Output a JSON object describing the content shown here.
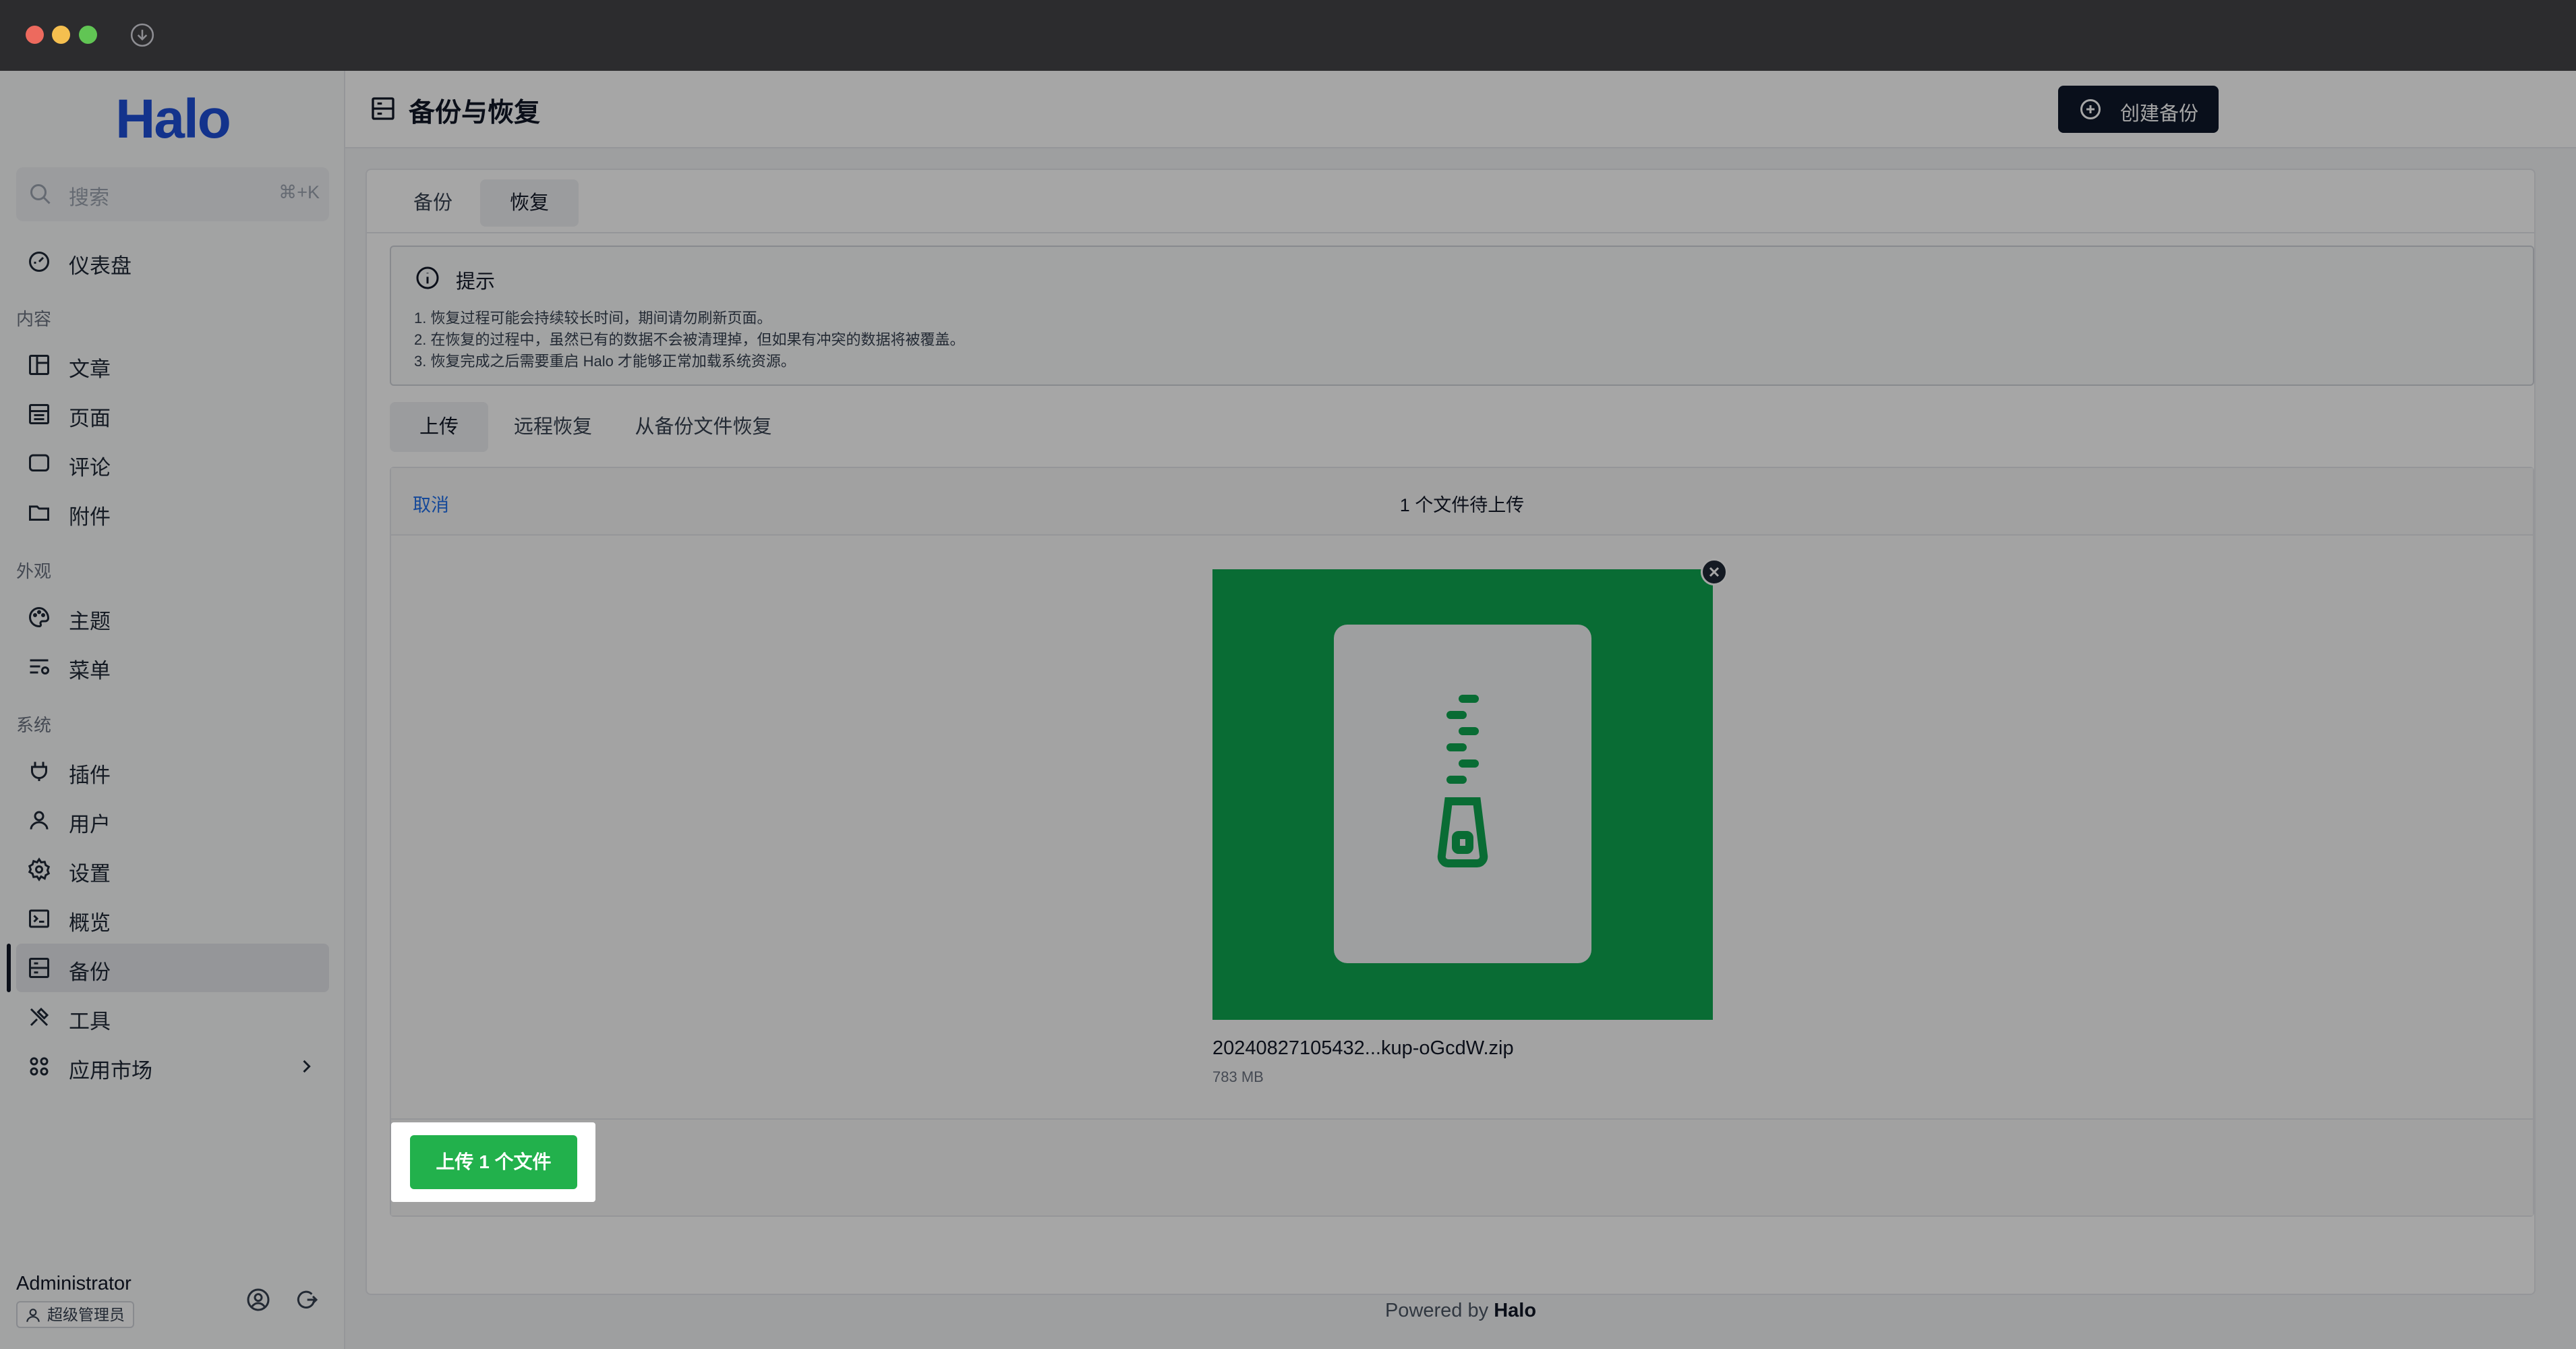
{
  "app": {
    "brand": "Halo"
  },
  "sidebar": {
    "search_placeholder": "搜索",
    "search_shortcut": "⌘+K",
    "dashboard": "仪表盘",
    "group_content": "内容",
    "posts": "文章",
    "pages": "页面",
    "comments": "评论",
    "attachments": "附件",
    "group_appearance": "外观",
    "themes": "主题",
    "menus": "菜单",
    "group_system": "系统",
    "plugins": "插件",
    "users": "用户",
    "settings": "设置",
    "overview": "概览",
    "backup": "备份",
    "tools": "工具",
    "app_market": "应用市场",
    "user_name": "Administrator",
    "user_role": "超级管理员"
  },
  "header": {
    "title": "备份与恢复",
    "create_backup": "创建备份"
  },
  "tabs": {
    "backup": "备份",
    "restore": "恢复"
  },
  "alert": {
    "title": "提示",
    "line1": "1. 恢复过程可能会持续较长时间，期间请勿刷新页面。",
    "line2": "2. 在恢复的过程中，虽然已有的数据不会被清理掉，但如果有冲突的数据将被覆盖。",
    "line3": "3. 恢复完成之后需要重启 Halo 才能够正常加载系统资源。"
  },
  "subtabs": {
    "upload": "上传",
    "remote": "远程恢复",
    "from_file": "从备份文件恢复"
  },
  "uploader": {
    "cancel": "取消",
    "status": "1 个文件待上传",
    "file_name": "20240827105432...kup-oGcdW.zip",
    "file_size": "783 MB",
    "upload_button": "上传 1 个文件"
  },
  "footer": {
    "powered_prefix": "Powered by",
    "powered_brand": "Halo"
  },
  "colors": {
    "accent": "#22b14c",
    "thumb": "#0fa650",
    "primary_dark": "#0f172a",
    "link": "#1f6feb"
  }
}
